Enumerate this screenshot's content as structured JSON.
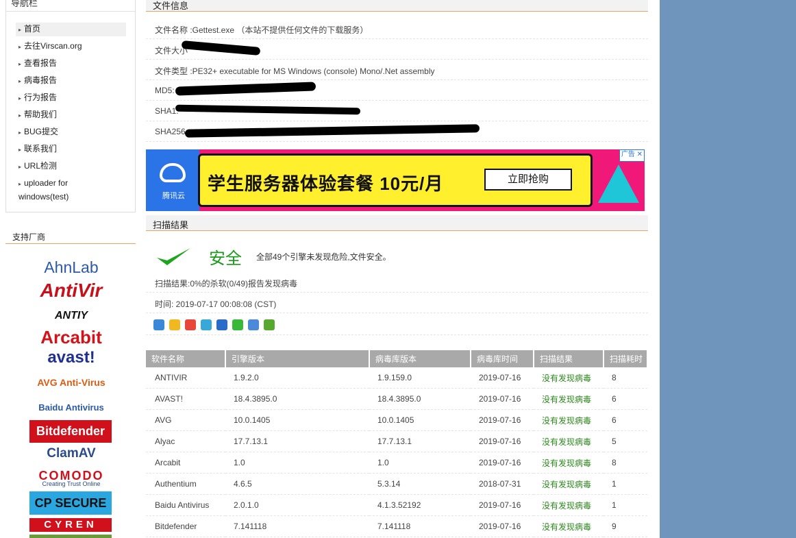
{
  "sidebar": {
    "title": "导航栏",
    "items": [
      {
        "label": "首页"
      },
      {
        "label": "去往Virscan.org"
      },
      {
        "label": "查看报告"
      },
      {
        "label": "病毒报告"
      },
      {
        "label": "行为报告"
      },
      {
        "label": "帮助我们"
      },
      {
        "label": "BUG提交"
      },
      {
        "label": "联系我们"
      },
      {
        "label": "URL检测"
      },
      {
        "label": "uploader for windows(test)"
      }
    ],
    "vendors_title": "支持厂商",
    "vendors": [
      "AhnLab",
      "AntiVir",
      "ANTIY",
      "Arcabit",
      "avast!",
      "AVG Anti-Virus",
      "Baidu Antivirus",
      "Bitdefender",
      "ClamAV",
      "COMODO",
      "Creating Trust Online",
      "CP SECURE",
      "CYREN"
    ]
  },
  "file_info": {
    "section_title": "文件信息",
    "rows": [
      {
        "label": "文件名称 :Gettest.exe （本站不提供任何文件的下载服务）"
      },
      {
        "label": "文件大小"
      },
      {
        "label": "文件类型 :PE32+ executable for MS Windows (console) Mono/.Net assembly"
      },
      {
        "label": "MD5:"
      },
      {
        "label": "SHA1:"
      },
      {
        "label": "SHA256"
      }
    ]
  },
  "ad": {
    "brand": "腾讯云",
    "headline": "学生服务器体验套餐 10元/月",
    "button": "立即抢购",
    "tag": "广告"
  },
  "scan": {
    "section_title": "扫描结果",
    "status": "安全",
    "status_desc": "全部49个引擎未发现危险,文件安全。",
    "summary": "扫描结果:0%的杀软(0/49)报告发现病毒",
    "time": "时间: 2019-07-17 00:08:08 (CST)",
    "share_icons": [
      "share-plus-icon",
      "qzone-icon",
      "weibo-icon",
      "tqq-icon",
      "renren-icon",
      "wechat-icon",
      "douban-icon",
      "kaixin-icon"
    ],
    "columns": [
      "软件名称",
      "引擎版本",
      "病毒库版本",
      "病毒库时间",
      "扫描结果",
      "扫描耗时"
    ],
    "rows": [
      [
        "ANTIVIR",
        "1.9.2.0",
        "1.9.159.0",
        "2019-07-16",
        "没有发现病毒",
        "8"
      ],
      [
        "AVAST!",
        "18.4.3895.0",
        "18.4.3895.0",
        "2019-07-16",
        "没有发现病毒",
        "6"
      ],
      [
        "AVG",
        "10.0.1405",
        "10.0.1405",
        "2019-07-16",
        "没有发现病毒",
        "6"
      ],
      [
        "Alyac",
        "17.7.13.1",
        "17.7.13.1",
        "2019-07-16",
        "没有发现病毒",
        "5"
      ],
      [
        "Arcabit",
        "1.0",
        "1.0",
        "2019-07-16",
        "没有发现病毒",
        "8"
      ],
      [
        "Authentium",
        "4.6.5",
        "5.3.14",
        "2018-07-31",
        "没有发现病毒",
        "1"
      ],
      [
        "Baidu Antivirus",
        "2.0.1.0",
        "4.1.3.52192",
        "2019-07-16",
        "没有发现病毒",
        "1"
      ],
      [
        "Bitdefender",
        "7.141118",
        "7.141118",
        "2019-07-16",
        "没有发现病毒",
        "9"
      ]
    ]
  },
  "colors": {
    "accent": "#f0a060",
    "safe": "#1a9a1a",
    "right_panel": "#7095bd"
  }
}
